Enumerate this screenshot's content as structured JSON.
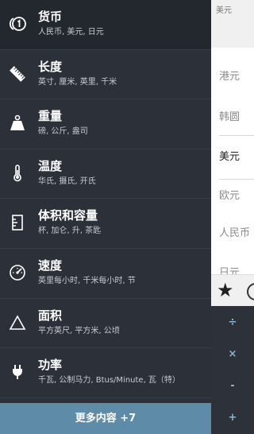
{
  "drawer": {
    "items": [
      {
        "title": "货币",
        "sub": "人民币, 美元, 日元",
        "icon": "currency-coin-icon"
      },
      {
        "title": "长度",
        "sub": "英寸, 厘米, 英里, 千米",
        "icon": "ruler-icon"
      },
      {
        "title": "重量",
        "sub": "磅, 公斤, 盎司",
        "icon": "weight-icon"
      },
      {
        "title": "温度",
        "sub": "华氏, 摄氏, 开氏",
        "icon": "thermometer-icon"
      },
      {
        "title": "体积和容量",
        "sub": "杯, 加仑, 升, 茶匙",
        "icon": "container-icon"
      },
      {
        "title": "速度",
        "sub": "英里每小时, 千米每小时, 节",
        "icon": "speedometer-icon"
      },
      {
        "title": "面积",
        "sub": "平方英尺, 平方米, 公顷",
        "icon": "triangle-area-icon"
      },
      {
        "title": "功率",
        "sub": "千瓦, 公制马力, Btus/Minute, 瓦（特）",
        "icon": "plug-icon"
      }
    ],
    "more_label": "更多内容 +7"
  },
  "converter": {
    "top_unit": "美元",
    "units": [
      "港元",
      "韩圆",
      "美元",
      "欧元",
      "人民币",
      "日元"
    ],
    "selected_unit": "美元",
    "ops": [
      "÷",
      "×",
      "-",
      "+"
    ]
  },
  "colors": {
    "drawer_bg": "#2c3038",
    "active_item_bg": "#23272e",
    "more_button_bg": "#5d8ba8",
    "operator_color": "#88b5d3"
  }
}
